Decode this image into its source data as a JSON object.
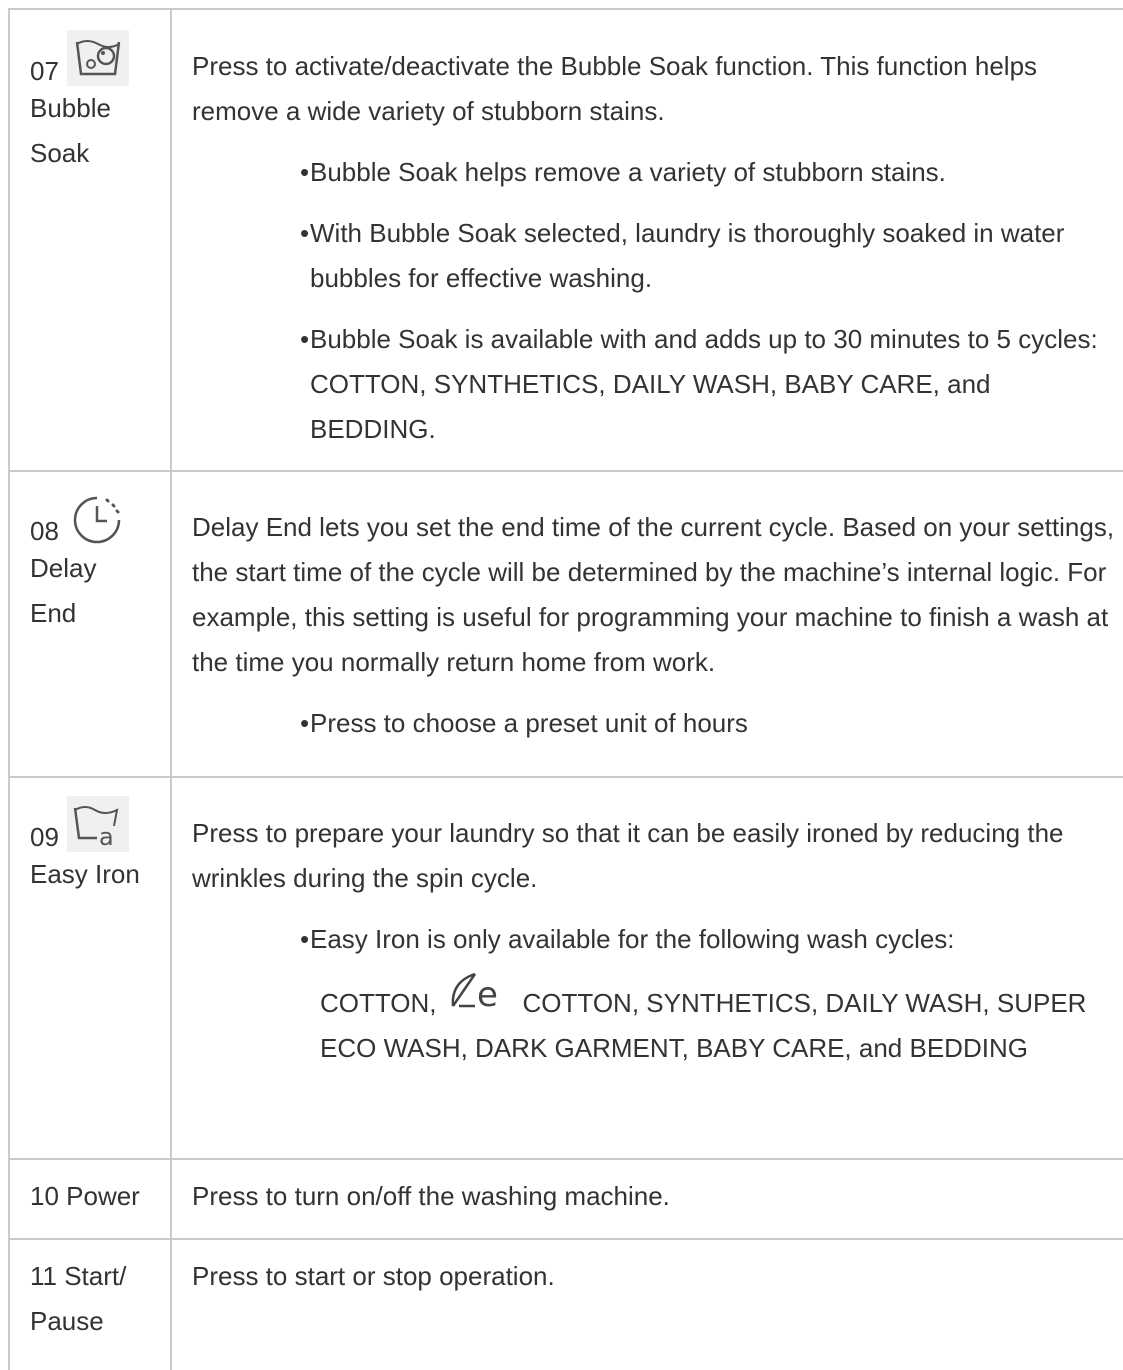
{
  "rows": [
    {
      "number": "07",
      "name_line1": "Bubble",
      "name_line2": "Soak",
      "icon": "bubble-soak-icon",
      "description": "Press to activate/deactivate the Bubble Soak function. This function helps remove a wide variety of stubborn stains.",
      "bullets": [
        "Bubble Soak helps remove a variety of stubborn stains.",
        "With Bubble Soak selected, laundry is thoroughly soaked in water bubbles for effective washing.",
        "Bubble Soak is available with and adds up to 30 minutes to 5 cycles: COTTON, SYNTHETICS, DAILY WASH, BABY CARE, and BEDDING."
      ]
    },
    {
      "number": "08",
      "name_line1": "Delay",
      "name_line2": "End",
      "icon": "delay-end-clock-icon",
      "description": "Delay End lets you set the end time of the current cycle. Based on your settings, the start time of the cycle will be determined by the machine’s internal logic. For example, this setting is useful for programming your machine to finish a wash at the time you normally return home from work.",
      "bullets": [
        "Press to choose a preset unit of hours"
      ]
    },
    {
      "number": "09",
      "name_line1": "Easy Iron",
      "icon": "easy-iron-icon",
      "description": "Press to prepare your laundry so that it can be easily ironed by reducing the wrinkles during the spin cycle.",
      "bullets": [
        "Easy Iron is only available for the following wash cycles:"
      ],
      "cycles_prefix": "COTTON,",
      "cycles_icon": "eco-cotton-icon",
      "cycles_rest": "COTTON, SYNTHETICS, DAILY WASH, SUPER ECO WASH, DARK GARMENT, BABY CARE, and BEDDING"
    },
    {
      "label": "10 Power",
      "description": "Press to turn on/off the washing machine."
    },
    {
      "label_line1": "11 Start/",
      "label_line2": "Pause",
      "description": "Press to start or stop operation."
    }
  ]
}
